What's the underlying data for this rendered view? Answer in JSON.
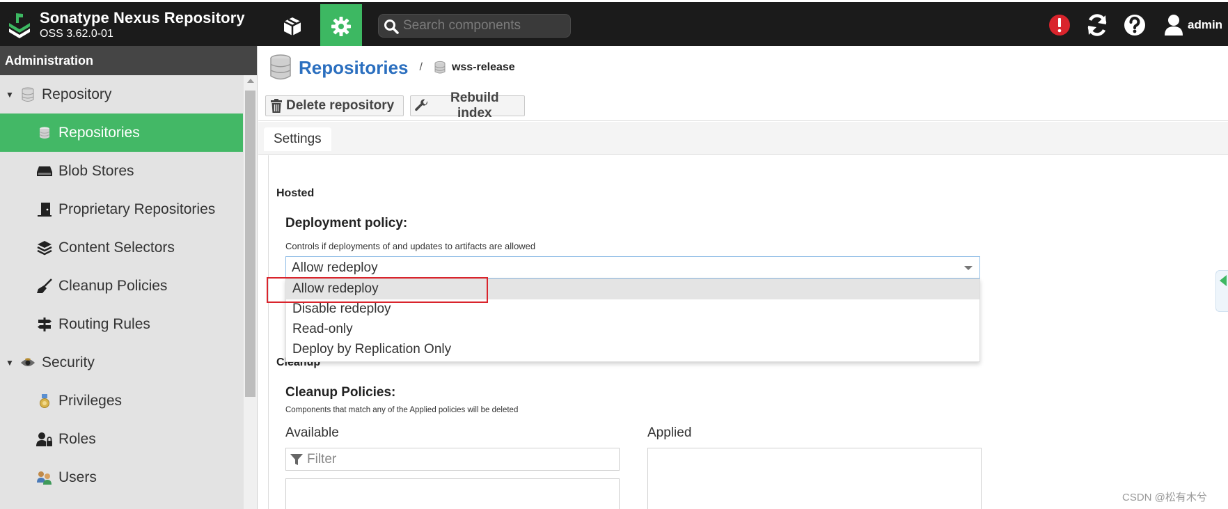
{
  "header": {
    "app_title": "Sonatype Nexus Repository",
    "app_version": "OSS 3.62.0-01",
    "search_placeholder": "Search components",
    "user_label": "admin",
    "browse_icon": "cube-icon",
    "admin_icon": "gear-icon",
    "status_icon": "alert-icon",
    "refresh_icon": "refresh-icon",
    "help_icon": "help-icon",
    "colors": {
      "bar": "#1b1b1b",
      "active": "#3db862",
      "alert": "#d9242c"
    }
  },
  "sidebar": {
    "title": "Administration",
    "items": [
      {
        "label": "Repository",
        "type": "group",
        "icon": "database-icon"
      },
      {
        "label": "Repositories",
        "type": "child",
        "icon": "database-icon",
        "active": true
      },
      {
        "label": "Blob Stores",
        "type": "child",
        "icon": "hdd-icon"
      },
      {
        "label": "Proprietary Repositories",
        "type": "child",
        "icon": "door-icon"
      },
      {
        "label": "Content Selectors",
        "type": "child",
        "icon": "layers-icon"
      },
      {
        "label": "Cleanup Policies",
        "type": "child",
        "icon": "broom-icon"
      },
      {
        "label": "Routing Rules",
        "type": "child",
        "icon": "signpost-icon"
      },
      {
        "label": "Security",
        "type": "group",
        "icon": "eye-icon"
      },
      {
        "label": "Privileges",
        "type": "child",
        "icon": "medal-icon"
      },
      {
        "label": "Roles",
        "type": "child",
        "icon": "user-lock-icon"
      },
      {
        "label": "Users",
        "type": "child",
        "icon": "users-icon"
      }
    ]
  },
  "breadcrumb": {
    "title": "Repositories",
    "separator": "/",
    "current": "wss-release"
  },
  "toolbar": {
    "delete_label": "Delete repository",
    "rebuild_label": "Rebuild index"
  },
  "tabs": [
    "Settings"
  ],
  "form": {
    "hosted_section": "Hosted",
    "deployment_label": "Deployment policy:",
    "deployment_help": "Controls if deployments of and updates to artifacts are allowed",
    "deployment_value": "Allow redeploy",
    "deployment_options": [
      "Allow redeploy",
      "Disable redeploy",
      "Read-only",
      "Deploy by Replication Only"
    ],
    "cleanup_section": "Cleanup",
    "cleanup_label": "Cleanup Policies:",
    "cleanup_help": "Components that match any of the Applied policies will be deleted",
    "available_label": "Available",
    "applied_label": "Applied",
    "filter_placeholder": "Filter"
  },
  "watermark": "CSDN @松有木兮"
}
